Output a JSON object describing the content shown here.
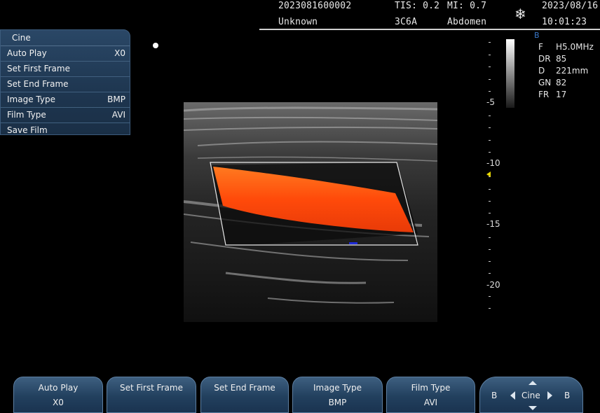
{
  "header": {
    "patient_id": "2023081600002",
    "patient_name": "Unknown",
    "tis": "TIS: 0.2",
    "probe": "3C6A",
    "mi": "MI: 0.7",
    "preset": "Abdomen",
    "freeze_icon": "snowflake-icon",
    "date": "2023/08/16",
    "time": "10:01:23"
  },
  "cine_menu": {
    "title": "Cine",
    "items": [
      {
        "label": "Auto Play",
        "value": "X0"
      },
      {
        "label": "Set First Frame",
        "value": ""
      },
      {
        "label": "Set End Frame",
        "value": ""
      },
      {
        "label": "Image Type",
        "value": "BMP"
      },
      {
        "label": "Film Type",
        "value": "AVI"
      },
      {
        "label": "Save Film",
        "value": ""
      }
    ]
  },
  "depth_scale": {
    "labels": [
      "-5",
      "-10",
      "-15",
      "-20"
    ]
  },
  "image_params": {
    "mode": "B",
    "rows": [
      {
        "key": "F",
        "value": "H5.0MHz"
      },
      {
        "key": "DR",
        "value": "85"
      },
      {
        "key": "D",
        "value": "221mm"
      },
      {
        "key": "GN",
        "value": "82"
      },
      {
        "key": "FR",
        "value": "17"
      }
    ]
  },
  "softkeys": [
    {
      "label": "Auto Play",
      "value": "X0"
    },
    {
      "label": "Set First Frame",
      "value": ""
    },
    {
      "label": "Set End Frame",
      "value": ""
    },
    {
      "label": "Image Type",
      "value": "BMP"
    },
    {
      "label": "Film Type",
      "value": "AVI"
    }
  ],
  "nav_key": {
    "left": "B",
    "center": "Cine",
    "right": "B"
  },
  "colors": {
    "doppler_flow": "#ff5a10",
    "panel": "#1e3650",
    "focus": "#e8d800"
  }
}
